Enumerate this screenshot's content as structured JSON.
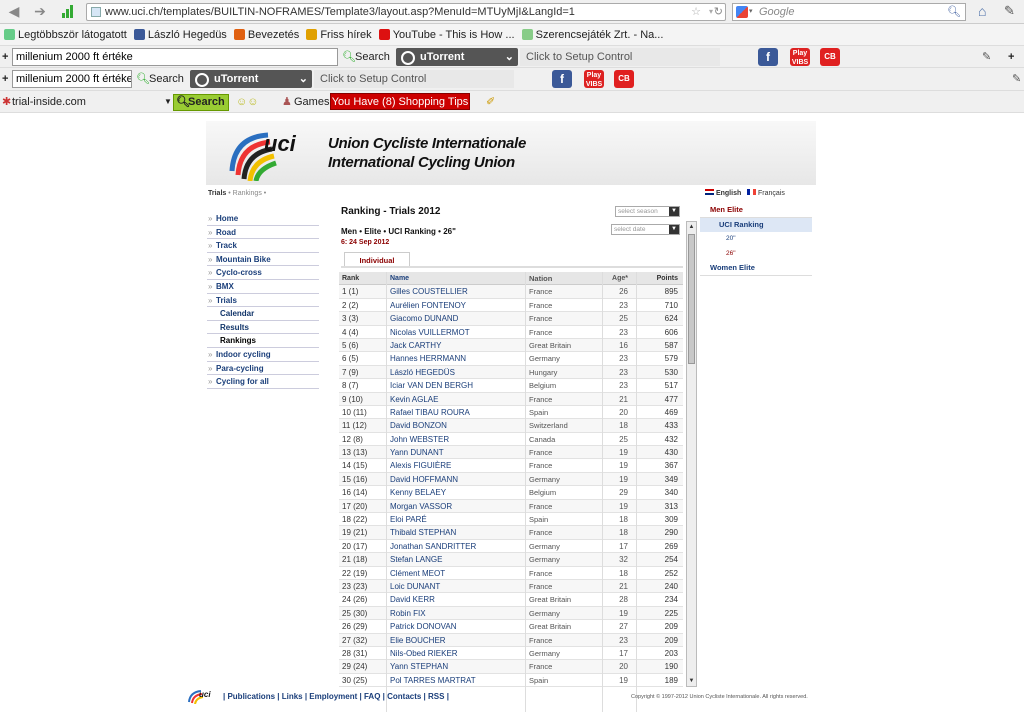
{
  "browser": {
    "url": "www.uci.ch/templates/BUILTIN-NOFRAMES/Template3/layout.asp?MenuId=MTUyMjI&LangId=1",
    "search_engine": "Google",
    "bookmarks": [
      {
        "label": "Legtöbbször látogatott",
        "color": "#6c8"
      },
      {
        "label": "László Hegedüs",
        "color": "#3b5998"
      },
      {
        "label": "Bevezetés",
        "color": "#e06010"
      },
      {
        "label": "Friss hírek",
        "color": "#e0a000"
      },
      {
        "label": "YouTube - This is How ...",
        "color": "#d11"
      },
      {
        "label": "Szerencsejáték Zrt. - Na...",
        "color": "#8c8"
      }
    ],
    "toolbar1": {
      "search_value": "millenium 2000 ft értéke",
      "search_label": "Search",
      "utorrent": "uTorrent",
      "setup": "Click to Setup Control"
    },
    "toolbar2": {
      "search_value": "millenium 2000 ft értéke",
      "search_label": "Search",
      "utorrent": "uTorrent",
      "setup": "Click to Setup Control"
    },
    "toolbar3": {
      "site": "trial-inside.com",
      "search_label": "Search",
      "games": "Games",
      "shopping": "You Have (8) Shopping Tips"
    },
    "icon_labels": {
      "facebook": "f",
      "play_top": "Play",
      "play_bottom": "VIBS",
      "cb": "CB"
    }
  },
  "site": {
    "org_line1": "Union Cycliste Internationale",
    "org_line2": "International Cycling Union",
    "breadcrumb_trials": "Trials",
    "breadcrumb_rest": "• Rankings •",
    "lang_en": "English",
    "lang_fr": "Français",
    "left_nav": [
      {
        "label": "Home",
        "type": "top"
      },
      {
        "label": "Road",
        "type": "top"
      },
      {
        "label": "Track",
        "type": "top"
      },
      {
        "label": "Mountain Bike",
        "type": "top"
      },
      {
        "label": "Cyclo-cross",
        "type": "top"
      },
      {
        "label": "BMX",
        "type": "top"
      },
      {
        "label": "Trials",
        "type": "top"
      },
      {
        "label": "Calendar",
        "type": "sub"
      },
      {
        "label": "Results",
        "type": "sub"
      },
      {
        "label": "Rankings",
        "type": "cur"
      },
      {
        "label": "Indoor cycling",
        "type": "top"
      },
      {
        "label": "Para-cycling",
        "type": "top"
      },
      {
        "label": "Cycling for all",
        "type": "top"
      }
    ],
    "right_nav": [
      {
        "label": "Men Elite",
        "type": "hd"
      },
      {
        "label": "UCI Ranking",
        "type": "act"
      },
      {
        "label": "20\"",
        "type": "s"
      },
      {
        "label": "26\"",
        "type": "s2"
      },
      {
        "label": "Women Elite",
        "type": "blue"
      }
    ],
    "title": "Ranking - Trials 2012",
    "subline": "Men • Elite • UCI Ranking • 26\"",
    "date": "6: 24 Sep 2012",
    "select_season": "select season",
    "select_date": "select date",
    "tab": "Individual",
    "columns": {
      "rank": "Rank",
      "name": "Name",
      "nation": "Nation",
      "age": "Age*",
      "points": "Points"
    },
    "rows": [
      {
        "rank": "1 (1)",
        "name": "Gilles COUSTELLIER",
        "nation": "France",
        "age": "26",
        "points": "895"
      },
      {
        "rank": "2 (2)",
        "name": "Aurélien FONTENOY",
        "nation": "France",
        "age": "23",
        "points": "710"
      },
      {
        "rank": "3 (3)",
        "name": "Giacomo DUNAND",
        "nation": "France",
        "age": "25",
        "points": "624"
      },
      {
        "rank": "4 (4)",
        "name": "Nicolas VUILLERMOT",
        "nation": "France",
        "age": "23",
        "points": "606"
      },
      {
        "rank": "5 (6)",
        "name": "Jack CARTHY",
        "nation": "Great Britain",
        "age": "16",
        "points": "587"
      },
      {
        "rank": "6 (5)",
        "name": "Hannes HERRMANN",
        "nation": "Germany",
        "age": "23",
        "points": "579"
      },
      {
        "rank": "7 (9)",
        "name": "László HEGEDÜS",
        "nation": "Hungary",
        "age": "23",
        "points": "530"
      },
      {
        "rank": "8 (7)",
        "name": "Iciar VAN DEN BERGH",
        "nation": "Belgium",
        "age": "23",
        "points": "517"
      },
      {
        "rank": "9 (10)",
        "name": "Kevin AGLAE",
        "nation": "France",
        "age": "21",
        "points": "477"
      },
      {
        "rank": "10 (11)",
        "name": "Rafael TIBAU ROURA",
        "nation": "Spain",
        "age": "20",
        "points": "469"
      },
      {
        "rank": "11 (12)",
        "name": "David BONZON",
        "nation": "Switzerland",
        "age": "18",
        "points": "433"
      },
      {
        "rank": "12 (8)",
        "name": "John WEBSTER",
        "nation": "Canada",
        "age": "25",
        "points": "432"
      },
      {
        "rank": "13 (13)",
        "name": "Yann DUNANT",
        "nation": "France",
        "age": "19",
        "points": "430"
      },
      {
        "rank": "14 (15)",
        "name": "Alexis FIGUIÈRE",
        "nation": "France",
        "age": "19",
        "points": "367"
      },
      {
        "rank": "15 (16)",
        "name": "David HOFFMANN",
        "nation": "Germany",
        "age": "19",
        "points": "349"
      },
      {
        "rank": "16 (14)",
        "name": "Kenny BELAEY",
        "nation": "Belgium",
        "age": "29",
        "points": "340"
      },
      {
        "rank": "17 (20)",
        "name": "Morgan VASSOR",
        "nation": "France",
        "age": "19",
        "points": "313"
      },
      {
        "rank": "18 (22)",
        "name": "Eloi PARÉ",
        "nation": "Spain",
        "age": "18",
        "points": "309"
      },
      {
        "rank": "19 (21)",
        "name": "Thibald STEPHAN",
        "nation": "France",
        "age": "18",
        "points": "290"
      },
      {
        "rank": "20 (17)",
        "name": "Jonathan SANDRITTER",
        "nation": "Germany",
        "age": "17",
        "points": "269"
      },
      {
        "rank": "21 (18)",
        "name": "Stefan LANGE",
        "nation": "Germany",
        "age": "32",
        "points": "254"
      },
      {
        "rank": "22 (19)",
        "name": "Clément MEOT",
        "nation": "France",
        "age": "18",
        "points": "252"
      },
      {
        "rank": "23 (23)",
        "name": "Loic DUNANT",
        "nation": "France",
        "age": "21",
        "points": "240"
      },
      {
        "rank": "24 (26)",
        "name": "David KERR",
        "nation": "Great Britain",
        "age": "28",
        "points": "234"
      },
      {
        "rank": "25 (30)",
        "name": "Robin FIX",
        "nation": "Germany",
        "age": "19",
        "points": "225"
      },
      {
        "rank": "26 (29)",
        "name": "Patrick DONOVAN",
        "nation": "Great Britain",
        "age": "27",
        "points": "209"
      },
      {
        "rank": "27 (32)",
        "name": "Elie BOUCHER",
        "nation": "France",
        "age": "23",
        "points": "209"
      },
      {
        "rank": "28 (31)",
        "name": "Nils-Obed RIEKER",
        "nation": "Germany",
        "age": "17",
        "points": "203"
      },
      {
        "rank": "29 (24)",
        "name": "Yann STEPHAN",
        "nation": "France",
        "age": "20",
        "points": "190"
      },
      {
        "rank": "30 (25)",
        "name": "Pol TARRES MARTRAT",
        "nation": "Spain",
        "age": "19",
        "points": "189"
      }
    ],
    "footer_logo": "uci",
    "footer_links": "| Publications | Links | Employment | FAQ | Contacts | RSS |",
    "copyright": "Copyright © 1997-2012 Union Cycliste Internationale. All rights reserved."
  }
}
